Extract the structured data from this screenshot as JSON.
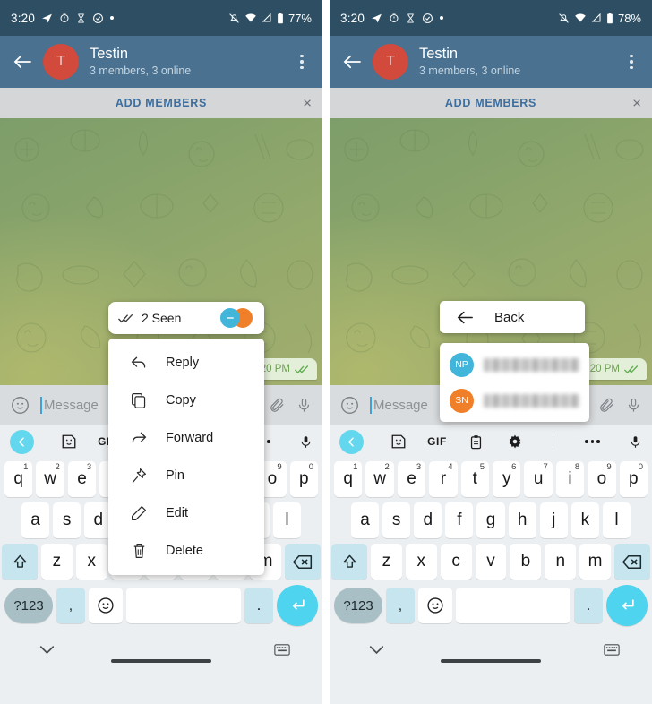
{
  "left": {
    "statusbar": {
      "time": "3:20",
      "battery": "77%",
      "icons": [
        "telegram-icon",
        "stopwatch-icon",
        "hourglass-icon",
        "clock-check-icon",
        "dot-icon"
      ],
      "right_icons": [
        "bell-off-icon",
        "wifi-icon",
        "signal-icon",
        "battery-icon"
      ]
    },
    "appbar": {
      "back": "back-arrow",
      "avatar_initial": "T",
      "title": "Testin",
      "subtitle": "3 members, 3 online",
      "menu": "more-options"
    },
    "addbar": {
      "label": "ADD MEMBERS",
      "close": "×"
    },
    "bubble": {
      "time": "3:20 PM",
      "ticks": "double-check"
    },
    "input": {
      "placeholder": "Message",
      "emoji": "emoji-icon",
      "attach": "paperclip-icon",
      "mic": "mic-icon"
    },
    "seen": {
      "label": "2 Seen",
      "ticks": "double-check"
    },
    "menu_items": [
      {
        "icon": "reply-icon",
        "label": "Reply"
      },
      {
        "icon": "copy-icon",
        "label": "Copy"
      },
      {
        "icon": "forward-icon",
        "label": "Forward"
      },
      {
        "icon": "pin-icon",
        "label": "Pin"
      },
      {
        "icon": "edit-icon",
        "label": "Edit"
      },
      {
        "icon": "delete-icon",
        "label": "Delete"
      }
    ]
  },
  "right": {
    "statusbar": {
      "time": "3:20",
      "battery": "78%"
    },
    "appbar": {
      "avatar_initial": "T",
      "title": "Testin",
      "subtitle": "3 members, 3 online"
    },
    "addbar": {
      "label": "ADD MEMBERS",
      "close": "×"
    },
    "bubble": {
      "time": "3:20 PM",
      "ticks": "double-check"
    },
    "input": {
      "placeholder": "Message"
    },
    "back_card": {
      "label": "Back",
      "icon": "back-arrow-icon"
    },
    "people": [
      {
        "initials": "NP",
        "color": "#41b6da",
        "name": ""
      },
      {
        "initials": "SN",
        "color": "#f07f2a",
        "name": ""
      }
    ]
  },
  "keyboard": {
    "toolbar": [
      "back-chevron",
      "sticker-icon",
      "GIF",
      "clipboard-icon",
      "gear-icon",
      "divider",
      "overflow-icon",
      "mic-icon"
    ],
    "gif_label": "GIF",
    "row1": [
      {
        "k": "q",
        "n": "1"
      },
      {
        "k": "w",
        "n": "2"
      },
      {
        "k": "e",
        "n": "3"
      },
      {
        "k": "r",
        "n": "4"
      },
      {
        "k": "t",
        "n": "5"
      },
      {
        "k": "y",
        "n": "6"
      },
      {
        "k": "u",
        "n": "7"
      },
      {
        "k": "i",
        "n": "8"
      },
      {
        "k": "o",
        "n": "9"
      },
      {
        "k": "p",
        "n": "0"
      }
    ],
    "row2": [
      "a",
      "s",
      "d",
      "f",
      "g",
      "h",
      "j",
      "k",
      "l"
    ],
    "row3": [
      "z",
      "x",
      "c",
      "v",
      "b",
      "n",
      "m"
    ],
    "shift": "shift-icon",
    "backspace": "backspace-icon",
    "sym_label": "?123",
    "comma": ",",
    "emoji": "emoji-icon",
    "space": "",
    "period": ".",
    "enter": "enter-icon"
  },
  "navbar": {
    "hide_keyboard": "chevron-down-icon",
    "switch_keyboard": "keyboard-switch-icon",
    "gesture": "gesture-bar"
  },
  "colors": {
    "status": "#2e4f63",
    "appbar": "#4a718f",
    "accent_blue": "#3e6e9e",
    "avatar_red": "#d14a3c",
    "key_accent": "#c6e5ef",
    "enter": "#4ed4ef",
    "bubble": "#e4efd9",
    "tick_green": "#5fae4e"
  }
}
